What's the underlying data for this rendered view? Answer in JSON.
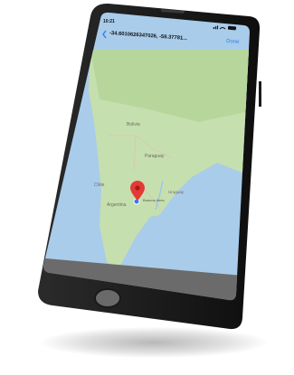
{
  "status_bar": {
    "time": "10:21",
    "signal_icon": "signal-bars-icon",
    "wifi_icon": "wifi-icon",
    "battery_icon": "battery-icon"
  },
  "nav_bar": {
    "back_icon": "chevron-left-icon",
    "title": "-34.6010626347026, -58.37781...",
    "done_label": "Done"
  },
  "map": {
    "pin_icon": "red-map-pin-icon",
    "location_dot_icon": "blue-location-dot-icon",
    "labels": {
      "bolivia": "Bolivia",
      "paraguay": "Paraguay",
      "chile": "Chile",
      "argentina": "Argentina",
      "uruguay": "Uruguay",
      "buenos_aires": "Buenos Aires"
    },
    "colors": {
      "land": "#c6dfae",
      "ocean": "#a9ccea",
      "pin": "#e53935",
      "location_dot": "#2f7cf6"
    }
  }
}
